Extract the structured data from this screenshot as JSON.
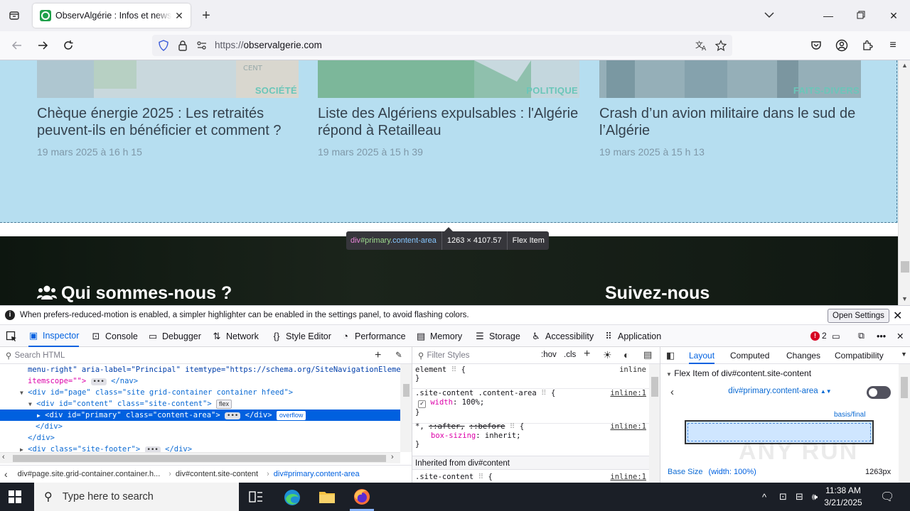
{
  "browser": {
    "tab_title": "ObservAlgérie : Infos et news pour...",
    "url_protocol": "https://",
    "url_host": "observalgerie.com"
  },
  "page": {
    "cards": [
      {
        "category": "SOCIÉTÉ",
        "headline": "Chèque énergie 2025 : Les retraités peuvent-ils en bénéficier et comment ?",
        "date": "19 mars 2025 à 16 h 15"
      },
      {
        "category": "POLITIQUE",
        "headline": "Liste des Algériens expulsables : l'Algérie répond à Retailleau",
        "date": "19 mars 2025 à 15 h 39"
      },
      {
        "category": "FAITS-DIVERS",
        "headline": "Crash d’un avion militaire dans le sud de l’Algérie",
        "date": "19 mars 2025 à 15 h 13"
      }
    ],
    "footer_left": "Qui sommes-nous ?",
    "footer_right": "Suivez-nous"
  },
  "inspector_tooltip": {
    "tag": "div",
    "id": "#primary",
    "cls": ".content-area",
    "size": "1263 × 4107.57",
    "type": "Flex Item"
  },
  "devtools": {
    "notice": "When prefers-reduced-motion is enabled, a simpler highlighter can be enabled in the settings panel, to avoid flashing colors.",
    "open_settings": "Open Settings",
    "tabs": [
      "Inspector",
      "Console",
      "Debugger",
      "Network",
      "Style Editor",
      "Performance",
      "Memory",
      "Storage",
      "Accessibility",
      "Application"
    ],
    "error_count": "2",
    "search_html_placeholder": "Search HTML",
    "filter_styles_placeholder": "Filter Styles",
    "hov": ":hov",
    "cls": ".cls",
    "tree": {
      "l1_attrs": "menu-right\" aria-label=\"Principal\" itemtype=\"https://schema.org/SiteNavigationElement\"",
      "l2": "itemscope=\"\">",
      "l2_close": "</nav>",
      "l3": "<div id=\"page\" class=\"site grid-container container hfeed\">",
      "l4": "<div id=\"content\" class=\"site-content\">",
      "l4_badge": "flex",
      "l5": "<div id=\"primary\" class=\"content-area\">",
      "l5_close": "</div>",
      "l5_badge": "overflow",
      "l6": "</div>",
      "l7": "</div>",
      "l8": "<div class=\"site-footer\">",
      "l8_close": "</div>"
    },
    "breadcrumbs": [
      "div#page.site.grid-container.container.h...",
      "div#content.site-content",
      "div#primary.content-area"
    ],
    "rules": {
      "r1_sel": "element",
      "r1_src": "inline",
      "r2_sel": ".site-content .content-area",
      "r2_src": "inline:1",
      "r2_prop": "width",
      "r2_val": "100%;",
      "r3_sel_a": "*,",
      "r3_sel_b": "::after,",
      "r3_sel_c": "::before",
      "r3_src": "inline:1",
      "r3_prop": "box-sizing",
      "r3_val": "inherit;",
      "inherited": "Inherited from div#content",
      "r4_sel": ".site-content",
      "r4_src": "inline:1"
    },
    "layout_tabs": [
      "Layout",
      "Computed",
      "Changes",
      "Compatibility"
    ],
    "flex_header": "Flex Item of div#content.site-content",
    "flex_selector": "div#primary.content-area",
    "basis_label": "basis/final",
    "base_size_label": "Base Size",
    "base_size_detail": "(width: 100%)",
    "base_size_px": "1263px"
  },
  "taskbar": {
    "search_placeholder": "Type here to search",
    "time": "11:38 AM",
    "date": "3/21/2025"
  },
  "watermark": "ANY RUN"
}
